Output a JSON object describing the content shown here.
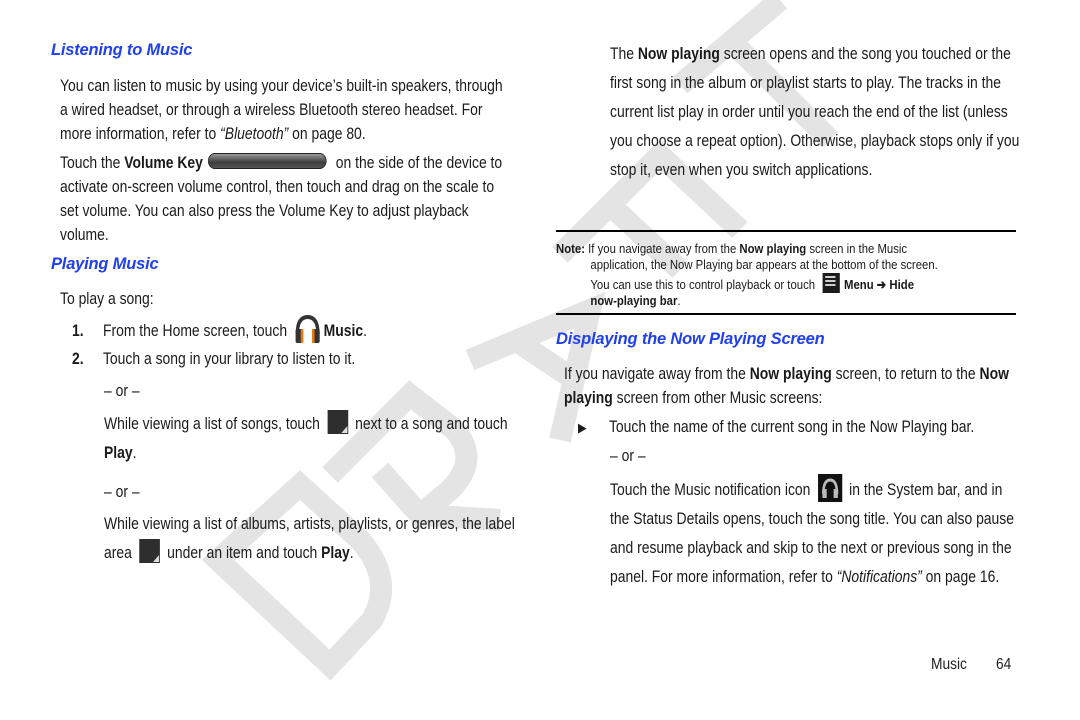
{
  "watermark": "DRAFT",
  "left": {
    "heading1": "Listening to Music",
    "intro": {
      "text1": "You can listen to music by using your device’s built-in speakers, through a wired headset, or through a wireless Bluetooth stereo headset. For more information, refer to ",
      "ref": "“Bluetooth”",
      "text2": " on page 80."
    },
    "volume": {
      "pre": "Touch the ",
      "bold": "Volume Key",
      "icon": "volume-key-icon",
      "post": " on the side of the device to activate on-screen volume control, then touch and drag on the scale to set volume. You can also press the Volume Key to adjust playback volume."
    },
    "heading2": "Playing Music",
    "to_play": "To play a song:",
    "step1": {
      "num": "1.",
      "pre": "From the Home screen, touch ",
      "icon": "headphones-music-icon",
      "bold": "Music",
      "post": "."
    },
    "step2": {
      "num": "2.",
      "text": "Touch a song in your library to listen to it."
    },
    "or1": "– or –",
    "alt1": {
      "pre": "While viewing a list of songs, touch ",
      "icon": "context-menu-corner-icon",
      "mid": " next to a song and touch ",
      "bold": "Play",
      "post": "."
    },
    "or2": "– or –",
    "alt2": {
      "pre": "While viewing a list of albums, artists, playlists, or genres, the label area ",
      "icon": "context-menu-corner-icon",
      "mid": " under an item and touch ",
      "bold": "Play",
      "post": "."
    }
  },
  "right": {
    "para": {
      "pre": "The ",
      "bold": "Now playing",
      "post": " screen opens and the song you touched or the first song in the album or playlist starts to play. The tracks in the current list play in order until you reach the end of the list (unless you choose a repeat option). Otherwise, playback stops only if you stop it, even when you switch applications."
    },
    "note": {
      "label": "Note:",
      "t1": " If you navigate away from the ",
      "b1": "Now playing",
      "t2": " screen in the Music",
      "line2": "application, the Now Playing bar appears at the bottom of the screen.",
      "line3_pre": "You can use this to control playback or touch ",
      "icon": "menu-icon",
      "b2": "Menu ➔ Hide",
      "b3": "now-playing bar",
      "end": "."
    },
    "heading3": "Displaying the Now Playing Screen",
    "return": {
      "t1": "If you navigate away from the ",
      "b1": "Now playing",
      "t2": " screen, to return to the ",
      "b2": "Now playing",
      "t3": " screen from other Music screens:"
    },
    "bullet": {
      "glyph": "▶",
      "text": "Touch the name of the current song in the Now Playing bar."
    },
    "or3": "– or –",
    "notif": {
      "pre": "Touch the Music notification icon ",
      "icon": "music-notification-icon",
      "post": " in the System bar, and in the Status Details opens, touch the song title. You can also pause and resume playback and skip to the next or previous song in the panel. For more information, refer to ",
      "ref": "“Notifications”",
      "end": " on page 16."
    }
  },
  "footer": {
    "section": "Music",
    "page": "64"
  },
  "colors": {
    "heading": "#2040ee",
    "watermark": "#e3e3e3",
    "text": "#1a1a1a"
  }
}
